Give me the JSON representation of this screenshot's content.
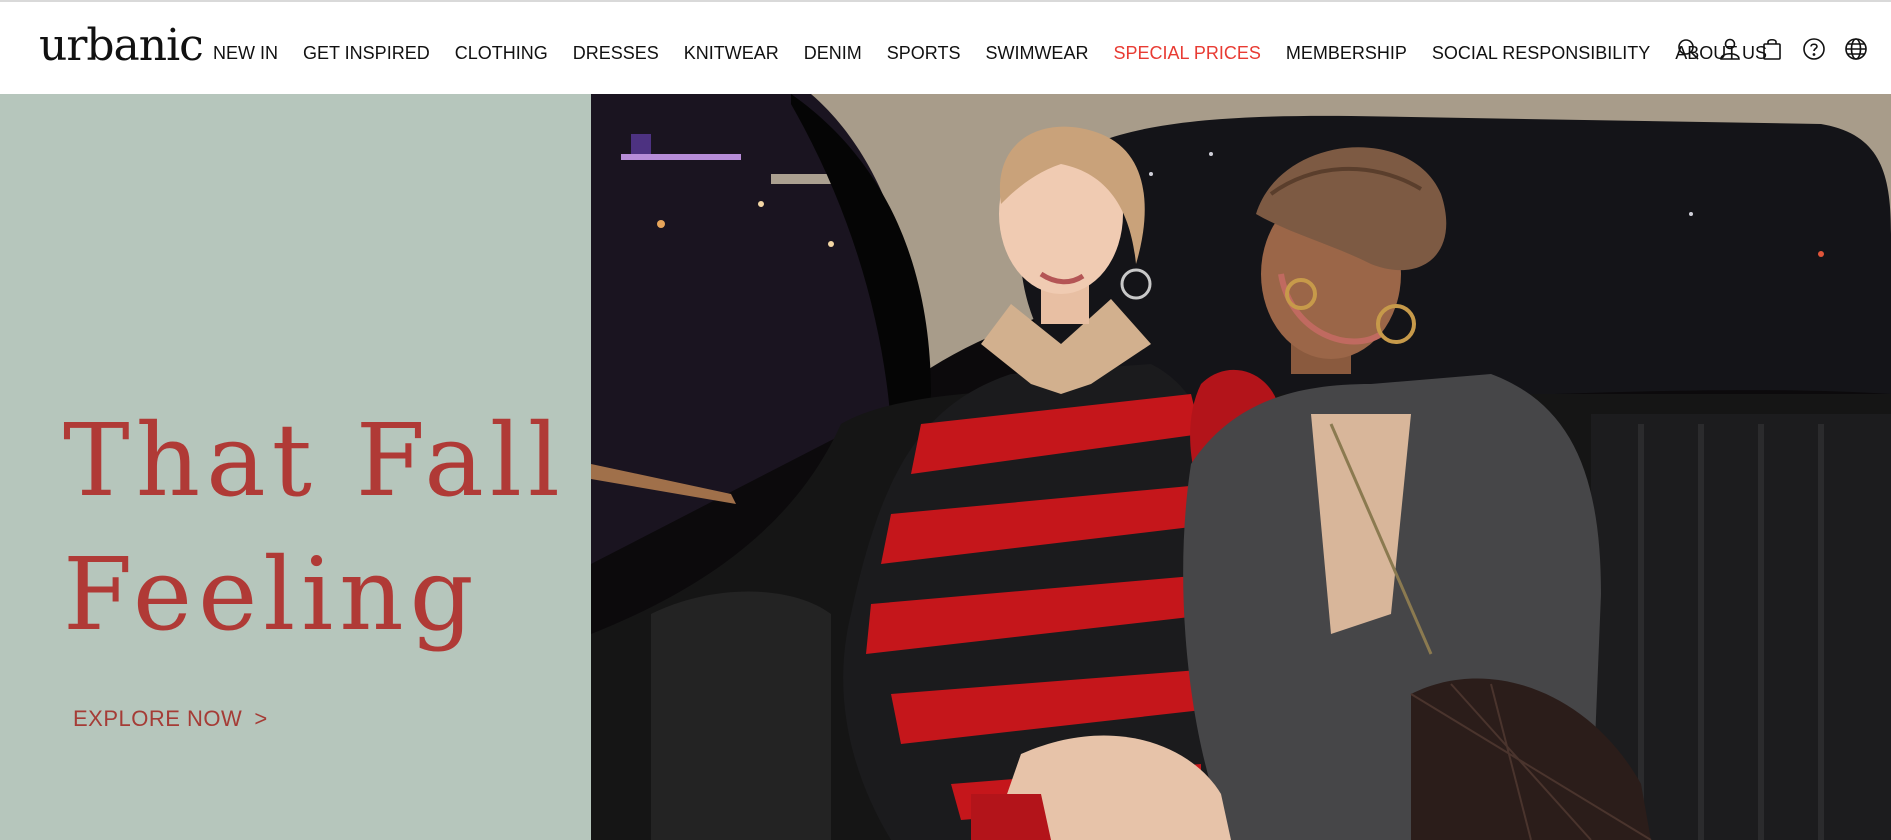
{
  "brand": {
    "logo_text": "urbanic"
  },
  "nav": {
    "items": [
      {
        "label": "NEW IN"
      },
      {
        "label": "GET INSPIRED"
      },
      {
        "label": "CLOTHING"
      },
      {
        "label": "DRESSES"
      },
      {
        "label": "KNITWEAR"
      },
      {
        "label": "DENIM"
      },
      {
        "label": "SPORTS"
      },
      {
        "label": "SWIMWEAR"
      },
      {
        "label": "SPECIAL PRICES",
        "highlight_color": "#e83b33"
      },
      {
        "label": "MEMBERSHIP"
      },
      {
        "label": "SOCIAL RESPONSIBILITY"
      },
      {
        "label": "ABOUT US"
      }
    ]
  },
  "header_icons": [
    "search-icon",
    "account-icon",
    "bag-icon",
    "help-icon",
    "globe-icon"
  ],
  "hero": {
    "title_line1": "That Fall",
    "title_line2": "Feeling",
    "cta_label": "EXPLORE NOW",
    "cta_chevron": ">",
    "panel_color": "#b6c6bc",
    "title_color": "#b03a36"
  }
}
